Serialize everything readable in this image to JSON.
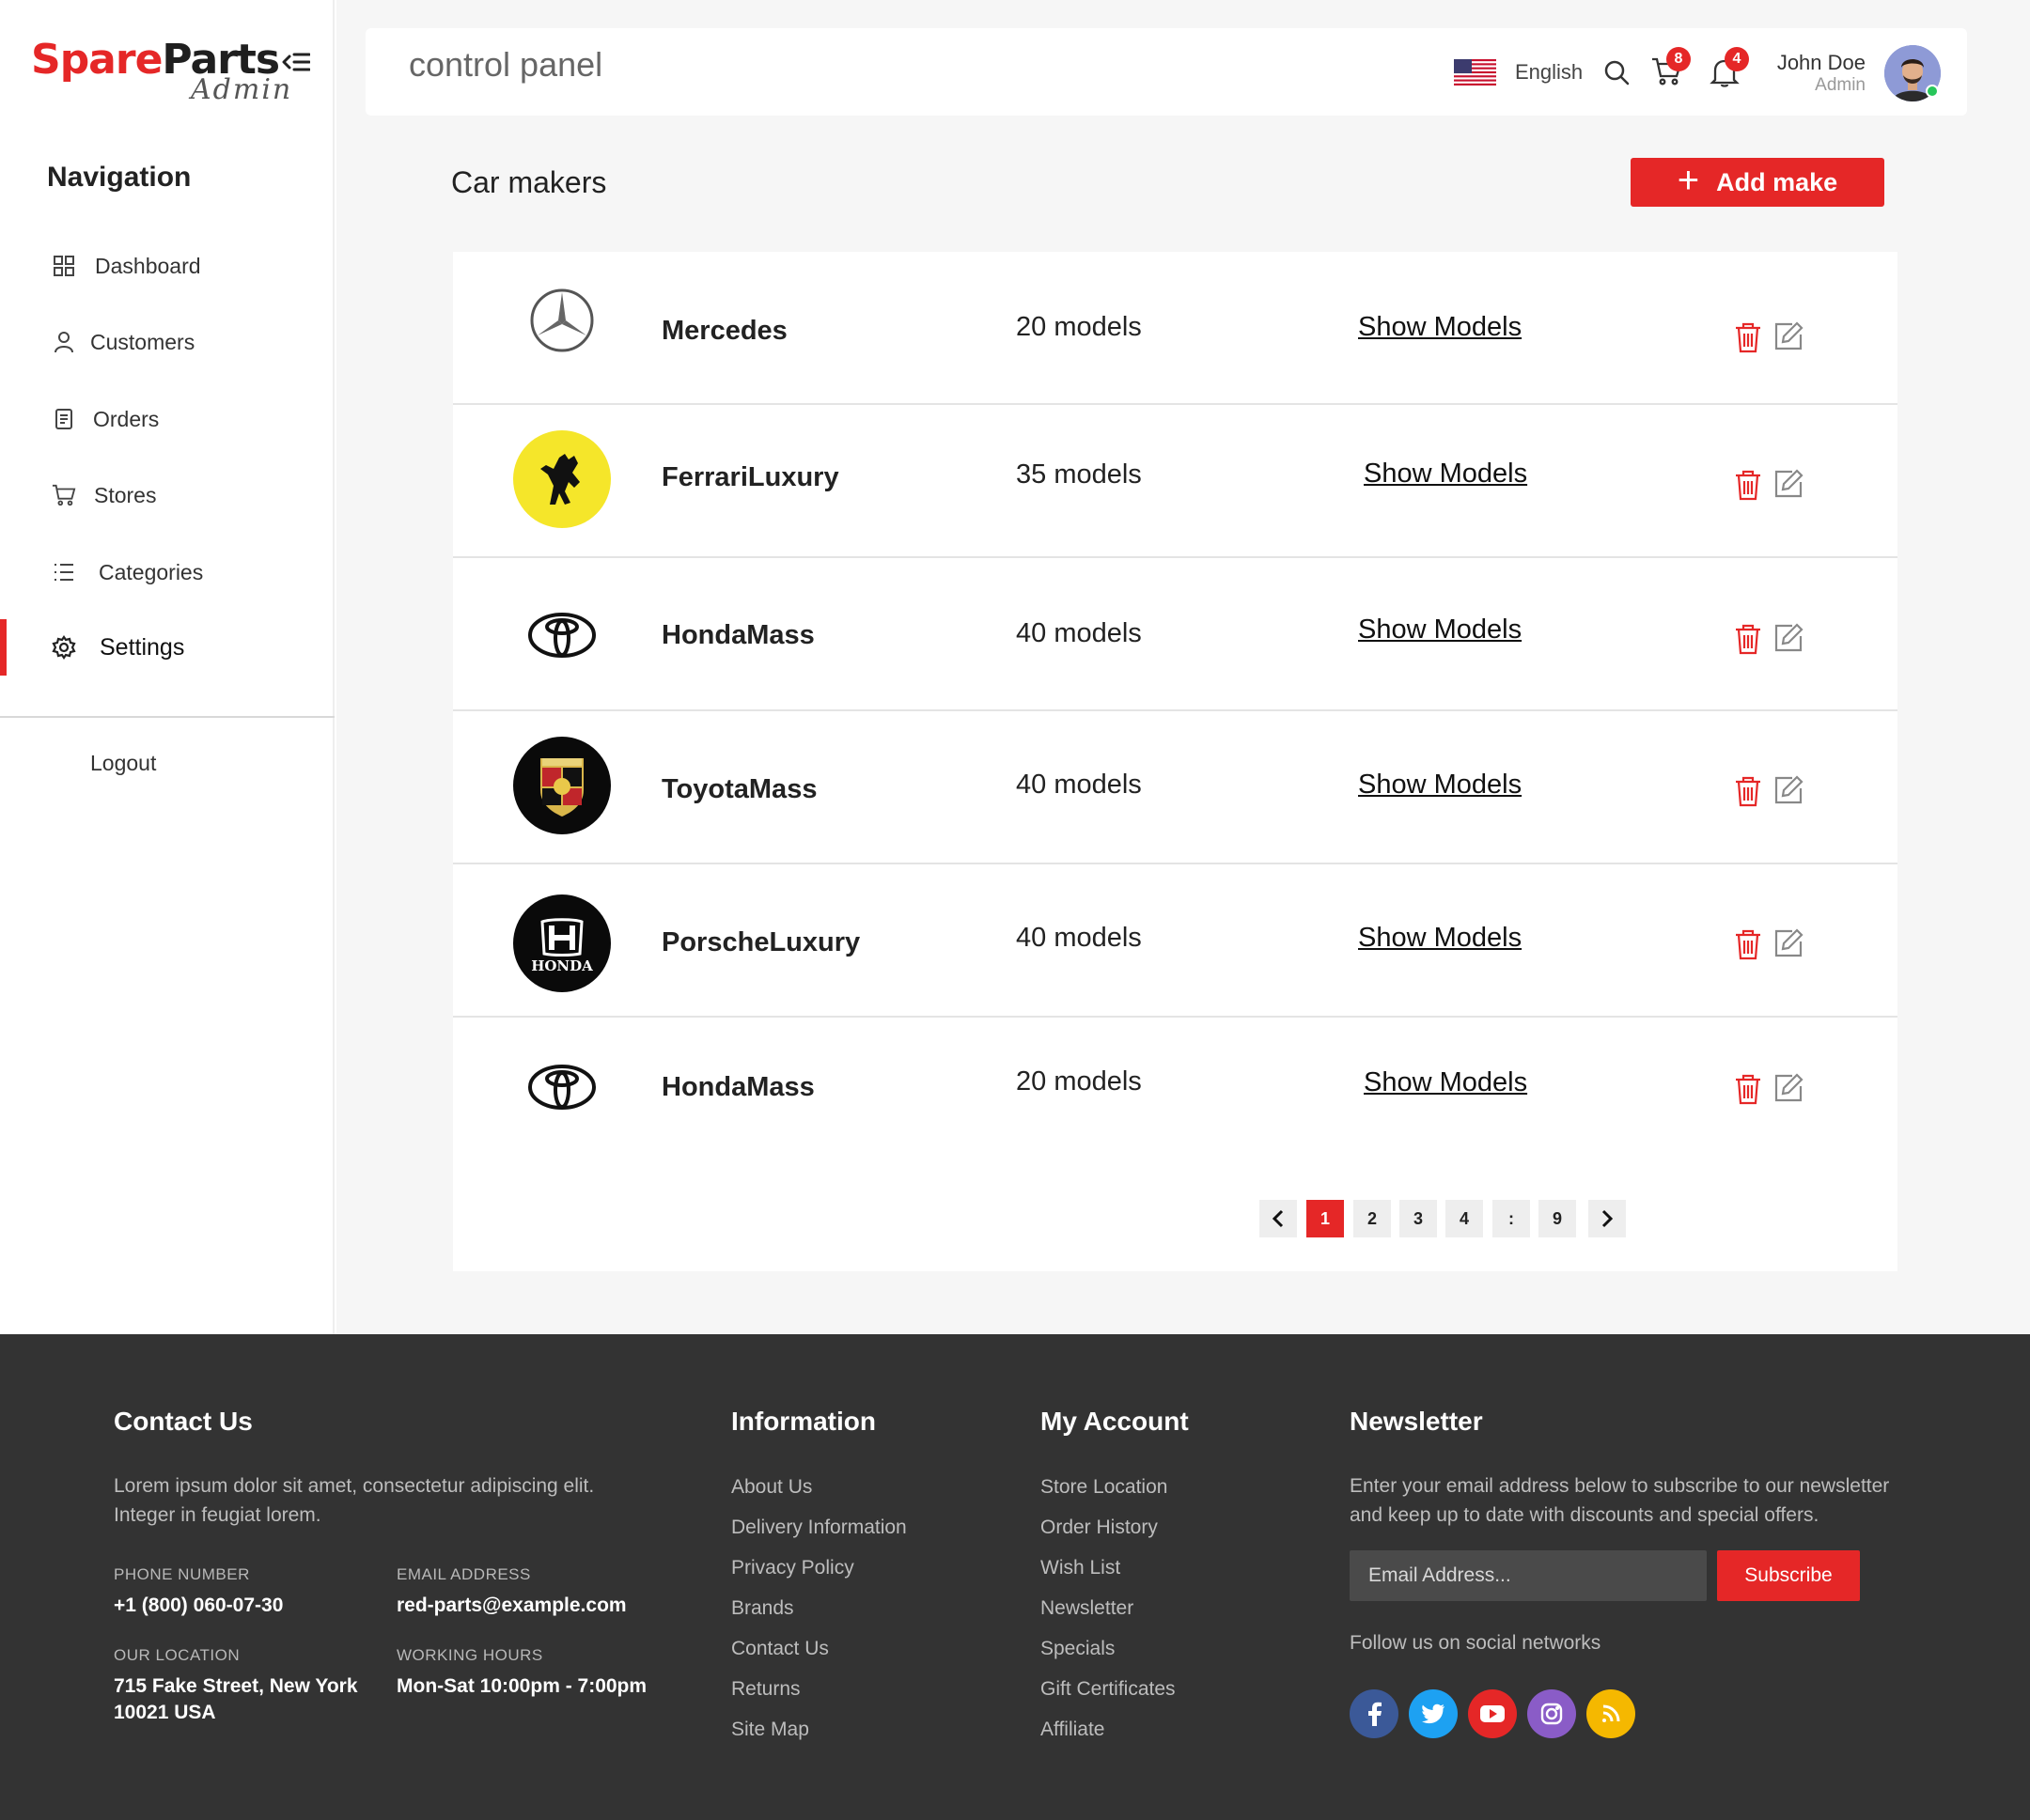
{
  "brand": {
    "spare": "Spare",
    "parts": "Parts",
    "admin": "Admin"
  },
  "sidebar": {
    "title": "Navigation",
    "items": [
      {
        "label": "Dashboard",
        "icon": "grid-icon"
      },
      {
        "label": "Customers",
        "icon": "user-icon"
      },
      {
        "label": "Orders",
        "icon": "document-icon"
      },
      {
        "label": "Stores",
        "icon": "cart-icon"
      },
      {
        "label": "Categories",
        "icon": "list-icon"
      },
      {
        "label": "Settings",
        "icon": "gear-icon",
        "active": true
      }
    ],
    "logout": "Logout"
  },
  "header": {
    "title": "control panel",
    "language": "English",
    "cart_count": "8",
    "notification_count": "4",
    "user": {
      "name": "John Doe",
      "role": "Admin"
    }
  },
  "page": {
    "title": "Car makers",
    "add_button": "Add make"
  },
  "makers": [
    {
      "name": "Mercedes",
      "models": "20 models",
      "link": "Show Models",
      "logo": "mercedes-logo"
    },
    {
      "name": "FerrariLuxury",
      "models": "35 models",
      "link": "Show Models",
      "logo": "ferrari-logo"
    },
    {
      "name": "HondaMass",
      "models": "40 models",
      "link": "Show Models",
      "logo": "toyota-logo"
    },
    {
      "name": "ToyotaMass",
      "models": "40 models",
      "link": "Show Models",
      "logo": "porsche-logo"
    },
    {
      "name": "PorscheLuxury",
      "models": "40 models",
      "link": "Show Models",
      "logo": "honda-logo",
      "logo_text": "HONDA"
    },
    {
      "name": "HondaMass",
      "models": "20 models",
      "link": "Show Models",
      "logo": "toyota-logo"
    }
  ],
  "pagination": {
    "pages": [
      "1",
      "2",
      "3",
      "4",
      ":",
      "9"
    ],
    "current": "1"
  },
  "footer": {
    "contact": {
      "title": "Contact Us",
      "text1": "Lorem ipsum dolor sit amet, consectetur adipiscing elit.",
      "text2": "Integer in feugiat lorem.",
      "phone_label": "PHONE NUMBER",
      "phone": "+1 (800) 060-07-30",
      "email_label": "EMAIL ADDRESS",
      "email": "red-parts@example.com",
      "location_label": "OUR LOCATION",
      "location1": "715 Fake Street, New York",
      "location2": "10021 USA",
      "hours_label": "WORKING HOURS",
      "hours": "Mon-Sat 10:00pm - 7:00pm"
    },
    "information": {
      "title": "Information",
      "links": [
        "About Us",
        "Delivery Information",
        "Privacy Policy",
        "Brands",
        "Contact Us",
        "Returns",
        "Site Map"
      ]
    },
    "account": {
      "title": "My Account",
      "links": [
        "Store Location",
        "Order History",
        "Wish List",
        "Newsletter",
        "Specials",
        "Gift Certificates",
        "Affiliate"
      ]
    },
    "newsletter": {
      "title": "Newsletter",
      "text1": "Enter your email address below to subscribe to our newsletter",
      "text2": "and keep up to date with discounts and special offers.",
      "placeholder": "Email Address...",
      "button": "Subscribe",
      "follow": "Follow us on social networks",
      "social": [
        {
          "name": "facebook-icon",
          "color": "#3b5998"
        },
        {
          "name": "twitter-icon",
          "color": "#1da1f2"
        },
        {
          "name": "youtube-icon",
          "color": "#e52727"
        },
        {
          "name": "instagram-icon",
          "color": "#8a5cc7"
        },
        {
          "name": "rss-icon",
          "color": "#f5b800"
        }
      ]
    }
  },
  "colors": {
    "accent": "#e52727",
    "footer": "#333333",
    "page_bg": "#f6f6f6"
  }
}
